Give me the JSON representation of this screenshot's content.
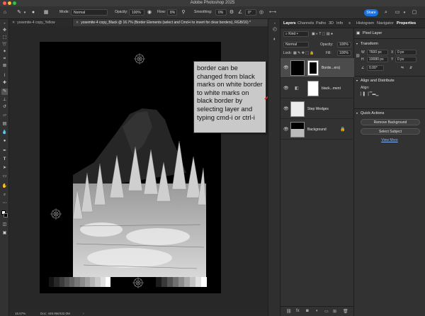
{
  "window": {
    "title": "Adobe Photoshop 2025"
  },
  "options_bar": {
    "mode_label": "Mode:",
    "mode_value": "Normal",
    "opacity_label": "Opacity:",
    "opacity_value": "100%",
    "flow_label": "Flow:",
    "flow_value": "8%",
    "smoothing_label": "Smoothing:",
    "smoothing_value": "0%",
    "angle_value": "0°",
    "share_label": "Share"
  },
  "doc_tabs": [
    {
      "label": "yosemite-4 copy_Yellow"
    },
    {
      "label": "yosemite-4 copy_Black @ 16.7% (Border Elements (select and Cmd+i to invert for clear borders), RGB/16) *"
    }
  ],
  "status": {
    "zoom": "16.67%",
    "doc": "Doc: 449.9M/432.0M"
  },
  "callout": {
    "text": "border can be changed from black marks on white border to white marks on black border by selecting layer and typing cmd-i or ctrl-i",
    "fill": "#c9c9c9",
    "arrow_color": "#e0241b"
  },
  "layers_panel": {
    "tabs": [
      "Layers",
      "Channels",
      "Paths",
      "3D",
      "Info"
    ],
    "kind_label": "Kind",
    "blend_mode": "Normal",
    "opacity_label": "Opacity:",
    "opacity_value": "100%",
    "lock_label": "Lock:",
    "fill_label": "Fill:",
    "fill_value": "100%",
    "layers": [
      {
        "name": "Borde...ers)"
      },
      {
        "name": "black...ment"
      },
      {
        "name": "Step Wedges"
      },
      {
        "name": "Background"
      }
    ]
  },
  "properties_panel": {
    "tabs": [
      "Histogram",
      "Navigator",
      "Properties"
    ],
    "layer_type": "Pixel Layer",
    "transform_title": "Transform",
    "w_label": "W",
    "w_value": "7600 px",
    "h_label": "H",
    "h_value": "10080 px",
    "x_value": "0 px",
    "y_value": "0 px",
    "angle_value": "0.00°",
    "align_title": "Align and Distribute",
    "align_label": "Align:",
    "quick_actions_title": "Quick Actions",
    "remove_bg_label": "Remove Background",
    "select_subject_label": "Select Subject",
    "view_more_label": "View More"
  },
  "icons": {
    "home": "home-icon",
    "brush": "brush-icon",
    "search": "search-icon",
    "gear": "gear-icon",
    "eye": "eye-icon",
    "lock": "lock-icon"
  },
  "accent_color": "#1473e6"
}
